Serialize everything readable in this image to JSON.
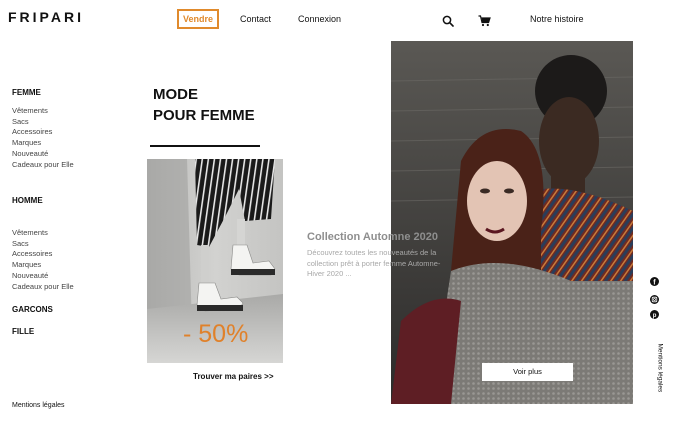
{
  "brand": {
    "logo": "FRIPARI"
  },
  "nav": {
    "vendre": "Vendre",
    "contact": "Contact",
    "connexion": "Connexion",
    "notre_histoire": "Notre histoire",
    "search_icon": "search-icon",
    "cart_icon": "cart-icon"
  },
  "sidebar": {
    "femme": {
      "title": "FEMME",
      "items": [
        "Vêtements",
        "Sacs",
        "Accessoires",
        "Marques",
        "Nouveauté",
        "Cadeaux pour Elle"
      ]
    },
    "homme": {
      "title": "HOMME",
      "items": [
        "Vêtements",
        "Sacs",
        "Accessoires",
        "Marques",
        "Nouveauté",
        "Cadeaux pour Elle"
      ]
    },
    "garcons": "GARCONS",
    "fille": "FILLE"
  },
  "main": {
    "headline_line1": "MODE",
    "headline_line2": "POUR FEMME",
    "discount": "- 50%",
    "shoe_link": "Trouver ma paires >>",
    "collection_title": "Collection Automne 2020",
    "collection_desc": "Découvrez toutes les nouveautés de la collection prêt à porter femme Automne-Hiver 2020 ...",
    "voir_plus": "Voir plus"
  },
  "footer": {
    "mentions": "Mentions légales",
    "mentions_vertical": "Mentions légales"
  },
  "social": [
    "facebook-icon",
    "instagram-icon",
    "pinterest-icon"
  ],
  "colors": {
    "accent": "#e08a2c",
    "discount": "#e0812a"
  }
}
